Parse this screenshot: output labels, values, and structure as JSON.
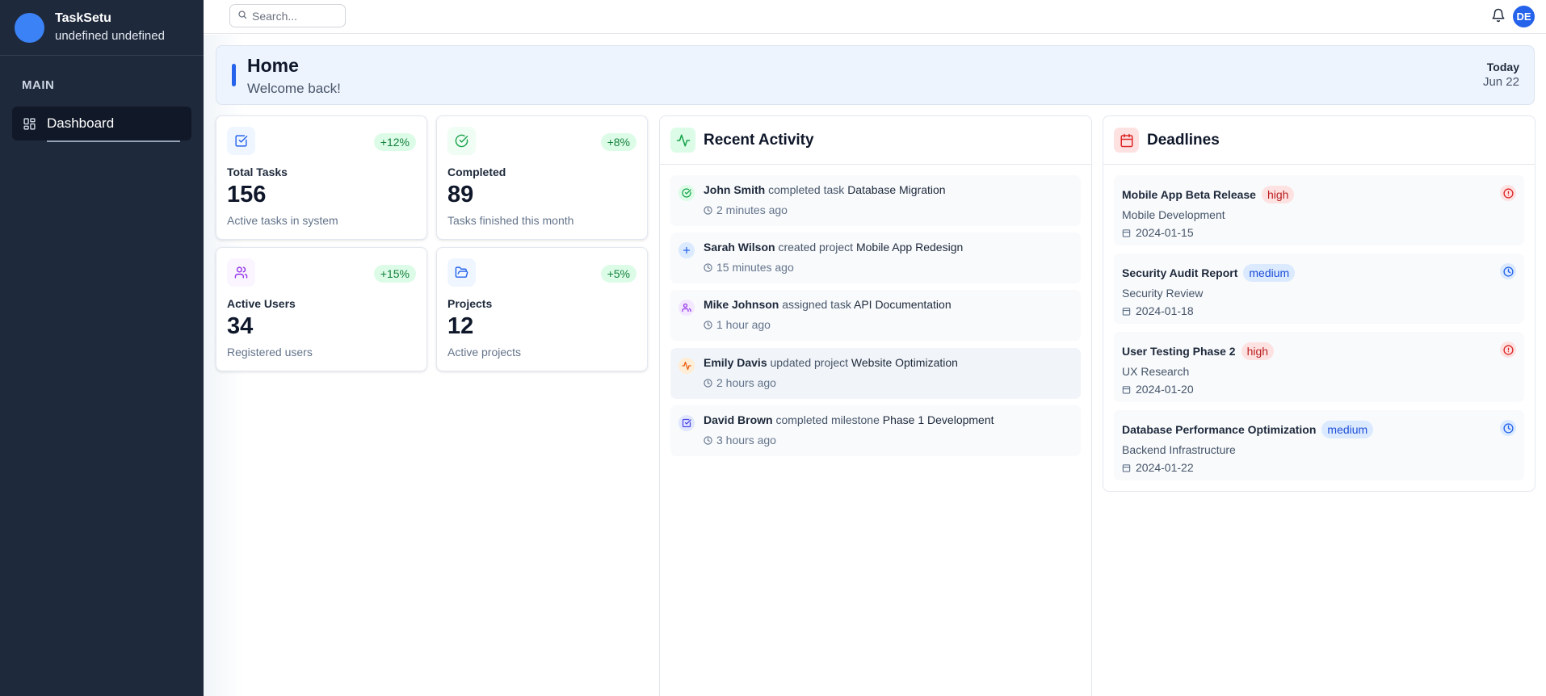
{
  "brand": {
    "name": "TaskSetu",
    "user": "undefined undefined"
  },
  "nav": {
    "section": "MAIN",
    "items": [
      {
        "label": "Dashboard",
        "icon": "grid-icon"
      }
    ]
  },
  "topbar": {
    "search_placeholder": "Search...",
    "avatar_initials": "DE"
  },
  "header": {
    "title": "Home",
    "subtitle": "Welcome back!",
    "today_label": "Today",
    "date": "Jun 22"
  },
  "stats": [
    {
      "label": "Total Tasks",
      "value": "156",
      "change": "+12%",
      "desc": "Active tasks in system",
      "icon": "check-square-icon",
      "color": "#2563eb"
    },
    {
      "label": "Completed",
      "value": "89",
      "change": "+8%",
      "desc": "Tasks finished this month",
      "icon": "check-circle-icon",
      "color": "#16a34a"
    },
    {
      "label": "Active Users",
      "value": "34",
      "change": "+15%",
      "desc": "Registered users",
      "icon": "users-icon",
      "color": "#9333ea"
    },
    {
      "label": "Projects",
      "value": "12",
      "change": "+5%",
      "desc": "Active projects",
      "icon": "folder-icon",
      "color": "#2563eb"
    }
  ],
  "activity": {
    "title": "Recent Activity",
    "items": [
      {
        "user": "John Smith",
        "action": "completed task",
        "object": "Database Migration",
        "time": "2 minutes ago",
        "icon": "check-circle-icon"
      },
      {
        "user": "Sarah Wilson",
        "action": "created project",
        "object": "Mobile App Redesign",
        "time": "15 minutes ago",
        "icon": "plus-icon"
      },
      {
        "user": "Mike Johnson",
        "action": "assigned task",
        "object": "API Documentation",
        "time": "1 hour ago",
        "icon": "users-icon"
      },
      {
        "user": "Emily Davis",
        "action": "updated project",
        "object": "Website Optimization",
        "time": "2 hours ago",
        "icon": "activity-icon"
      },
      {
        "user": "David Brown",
        "action": "completed milestone",
        "object": "Phase 1 Development",
        "time": "3 hours ago",
        "icon": "check-square-icon"
      }
    ]
  },
  "deadlines": {
    "title": "Deadlines",
    "items": [
      {
        "title": "Mobile App Beta Release",
        "priority": "high",
        "project": "Mobile Development",
        "date": "2024-01-15",
        "status_icon": "alert-circle-icon"
      },
      {
        "title": "Security Audit Report",
        "priority": "medium",
        "project": "Security Review",
        "date": "2024-01-18",
        "status_icon": "clock-icon"
      },
      {
        "title": "User Testing Phase 2",
        "priority": "high",
        "project": "UX Research",
        "date": "2024-01-20",
        "status_icon": "alert-circle-icon"
      },
      {
        "title": "Database Performance Optimization",
        "priority": "medium",
        "project": "Backend Infrastructure",
        "date": "2024-01-22",
        "status_icon": "clock-icon"
      }
    ]
  }
}
